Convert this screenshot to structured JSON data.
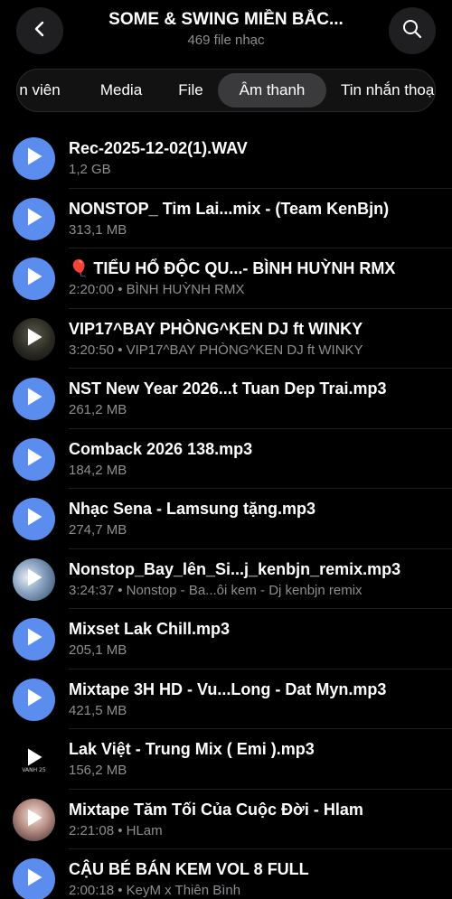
{
  "header": {
    "title": "SOME & SWING MIỀN BẮC...",
    "subtitle": "469 file nhạc",
    "back_icon": "chevron-left-icon",
    "search_icon": "search-icon"
  },
  "tabs": [
    {
      "label": "n viên"
    },
    {
      "label": "Media"
    },
    {
      "label": "File"
    },
    {
      "label": "Âm thanh",
      "active": true
    },
    {
      "label": "Tin nhắn thoạ"
    }
  ],
  "files": [
    {
      "title": "Rec-2025-12-02(1).WAV",
      "subtitle": "1,2 GB",
      "thumb": "blue"
    },
    {
      "title": "NONSTOP_ Tim Lai...mix - (Team KenBjn)",
      "subtitle": "313,1 MB",
      "thumb": "blue"
    },
    {
      "title": "🎈 TIỂU HỔ ĐỘC QU...- BÌNH HUỲNH RMX",
      "subtitle": "2:20:00 • BÌNH HUỲNH RMX",
      "thumb": "blue"
    },
    {
      "title": "VIP17^BAY PHÒNG^KEN DJ ft WINKY",
      "subtitle": "3:20:50 • VIP17^BAY PHÒNG^KEN DJ ft WINKY",
      "thumb": "img1"
    },
    {
      "title": "NST New Year 2026...t Tuan Dep Trai.mp3",
      "subtitle": "261,2 MB",
      "thumb": "blue"
    },
    {
      "title": "Comback 2026 138.mp3",
      "subtitle": "184,2 MB",
      "thumb": "blue"
    },
    {
      "title": "Nhạc Sena - Lamsung tặng.mp3",
      "subtitle": "274,7 MB",
      "thumb": "blue"
    },
    {
      "title": "Nonstop_Bay_lên_Si...j_kenbjn_remix.mp3",
      "subtitle": "3:24:37 • Nonstop -  Ba...ôi kem - Dj kenbjn remix",
      "thumb": "img2"
    },
    {
      "title": "Mixset Lak Chill.mp3",
      "subtitle": "205,1 MB",
      "thumb": "blue"
    },
    {
      "title": "Mixtape 3H HD - Vu...Long - Dat Myn.mp3",
      "subtitle": "421,5 MB",
      "thumb": "blue"
    },
    {
      "title": "Lak Việt - Trung Mix ( Emi ).mp3",
      "subtitle": "156,2 MB",
      "thumb": "img3",
      "thumb_text": "VANH 25"
    },
    {
      "title": "Mixtape Tăm Tối Của Cuộc Đời - Hlam",
      "subtitle": "2:21:08 • HLam",
      "thumb": "img4"
    },
    {
      "title": "CẬU BÉ BÁN KEM VOL 8 FULL",
      "subtitle": "2:00:18 • KeyM x Thiên Bình",
      "thumb": "blue"
    }
  ],
  "colors": {
    "accent": "#5b8def",
    "background": "#000000",
    "secondary_text": "#8e8e93"
  }
}
